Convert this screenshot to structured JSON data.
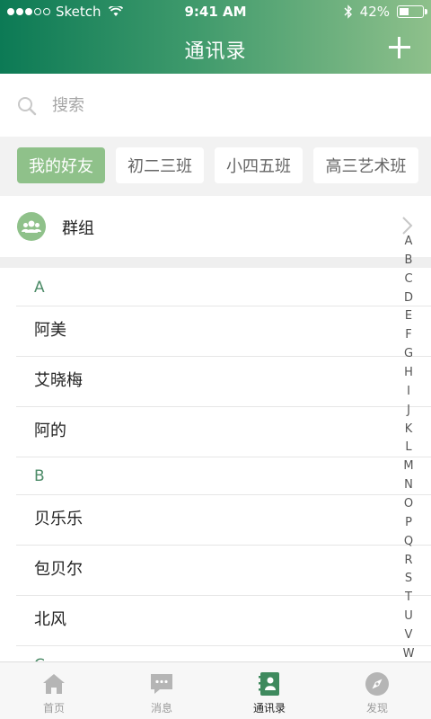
{
  "status_bar": {
    "carrier": "Sketch",
    "time": "9:41 AM",
    "battery": "42%",
    "battery_level": 0.42
  },
  "nav": {
    "title": "通讯录",
    "add_icon": "plus-icon"
  },
  "search": {
    "placeholder": "搜索",
    "value": ""
  },
  "class_tabs": [
    {
      "label": "我的好友",
      "active": true
    },
    {
      "label": "初二三班",
      "active": false
    },
    {
      "label": "小四五班",
      "active": false
    },
    {
      "label": "高三艺术班",
      "active": false
    }
  ],
  "groups": {
    "label": "群组",
    "icon": "group-icon"
  },
  "contacts": {
    "sections": [
      {
        "letter": "A",
        "items": [
          "阿美",
          "艾晓梅",
          "阿的"
        ]
      },
      {
        "letter": "B",
        "items": [
          "贝乐乐",
          "包贝尔",
          "北风"
        ]
      },
      {
        "letter": "C",
        "items": []
      }
    ]
  },
  "alpha_index": [
    "A",
    "B",
    "C",
    "D",
    "E",
    "F",
    "G",
    "H",
    "I",
    "J",
    "K",
    "L",
    "M",
    "N",
    "O",
    "P",
    "Q",
    "R",
    "S",
    "T",
    "U",
    "V",
    "W"
  ],
  "tab_bar": {
    "items": [
      {
        "label": "首页",
        "icon": "home-icon",
        "active": false
      },
      {
        "label": "消息",
        "icon": "message-icon",
        "active": false
      },
      {
        "label": "通讯录",
        "icon": "contacts-icon",
        "active": true
      },
      {
        "label": "发现",
        "icon": "compass-icon",
        "active": false
      }
    ]
  },
  "colors": {
    "accent": "#8fc18a",
    "header_start": "#0c7a55",
    "header_end": "#8ec08b",
    "section_letter": "#4e8c69"
  }
}
